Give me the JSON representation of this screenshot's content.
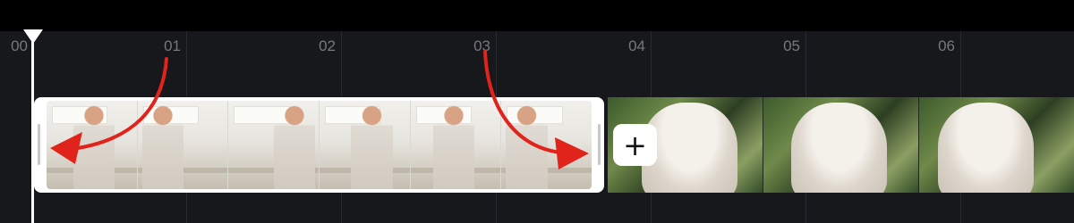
{
  "timeline": {
    "ticks": [
      "00",
      "01",
      "02",
      "03",
      "04",
      "05",
      "06"
    ]
  },
  "clips": [
    {
      "name": "Woman in kitchen",
      "frames": 6,
      "selected": true
    },
    {
      "name": "White cat",
      "frames": 3,
      "selected": false
    }
  ],
  "add_button": {
    "label": "+"
  },
  "colors": {
    "background": "#17181c",
    "arrow": "#e0231b",
    "selection": "#ffffff"
  }
}
